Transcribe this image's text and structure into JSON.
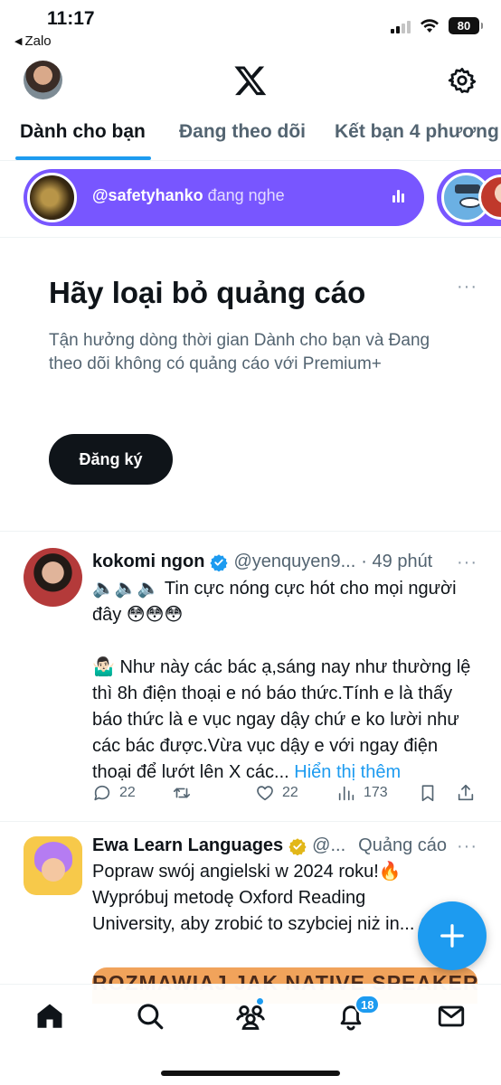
{
  "status_bar": {
    "time": "11:17",
    "back_app": "Zalo",
    "battery": "80"
  },
  "header": {
    "logo_icon": "x-logo-icon",
    "settings_icon": "gear-icon"
  },
  "tabs": [
    {
      "label": "Dành cho bạn",
      "active": true
    },
    {
      "label": "Đang theo dõi",
      "active": false
    },
    {
      "label": "Kết bạn 4 phương",
      "active": false
    }
  ],
  "space": {
    "host": "@safetyhanko",
    "status": " đang nghe"
  },
  "premium_card": {
    "title": "Hãy loại bỏ quảng cáo",
    "body": "Tận hưởng dòng thời gian Dành cho bạn và Đang theo dõi không có quảng cáo với Premium+",
    "button": "Đăng ký"
  },
  "tweet": {
    "name": "kokomi ngon",
    "handle": "@yenquyen9...",
    "time": "· 49 phút",
    "text": "🔈🔈🔈 Tin cực nóng cực hót cho mọi người đây 😳😳😳\n\n🤷🏻‍♂️ Như này các bác ạ,sáng nay như thường lệ thì 8h điện thoại e nó báo thức.Tính e là thấy báo thức là e vục ngay dậy chứ e ko lười như các bác được.Vừa vục dậy e với ngay điện thoại để lướt lên X các... ",
    "show_more": "Hiển thị thêm",
    "replies": "22",
    "likes": "22",
    "views": "173"
  },
  "ad_tweet": {
    "name": "Ewa Learn Languages",
    "handle": "@...",
    "label": "Quảng cáo",
    "text": "Popraw swój angielski w 2024 roku!🔥 Wypróbuj metodę Oxford Reading University, aby zrobić to szybciej niż in... 😉",
    "banner": "ROZMAWIAJ JAK NATIVE SPEAKER"
  },
  "bottom_nav": {
    "notifications_badge": "18"
  },
  "colors": {
    "accent": "#1d9bf0",
    "spaces": "#7856ff",
    "text": "#0f1419",
    "muted": "#536471"
  }
}
